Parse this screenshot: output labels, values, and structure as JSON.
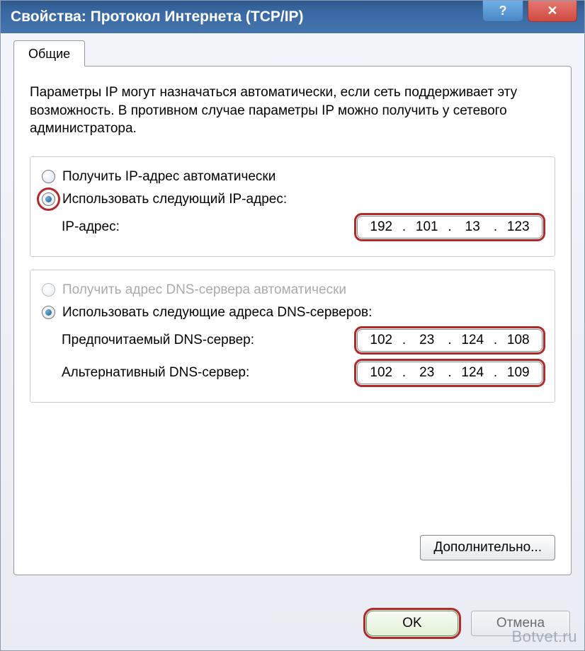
{
  "titlebar": {
    "title": "Свойства: Протокол Интернета (TCP/IP)",
    "help_icon": "?",
    "close_icon": "✕"
  },
  "tab": {
    "label": "Общие"
  },
  "description": "Параметры IP могут назначаться автоматически, если сеть поддерживает эту возможность. В противном случае параметры IP можно получить у сетевого администратора.",
  "ip_group": {
    "auto_label": "Получить IP-адрес автоматически",
    "manual_label": "Использовать следующий IP-адрес:",
    "ip_label": "IP-адрес:",
    "ip_value": [
      "192",
      "101",
      "13",
      "123"
    ]
  },
  "dns_group": {
    "auto_label": "Получить адрес DNS-сервера автоматически",
    "manual_label": "Использовать следующие адреса DNS-серверов:",
    "preferred_label": "Предпочитаемый DNS-сервер:",
    "preferred_value": [
      "102",
      "23",
      "124",
      "108"
    ],
    "alternate_label": "Альтернативный DNS-сервер:",
    "alternate_value": [
      "102",
      "23",
      "124",
      "109"
    ]
  },
  "buttons": {
    "advanced": "Дополнительно...",
    "ok": "OK",
    "cancel": "Отмена"
  },
  "watermark": "Botvet.ru"
}
